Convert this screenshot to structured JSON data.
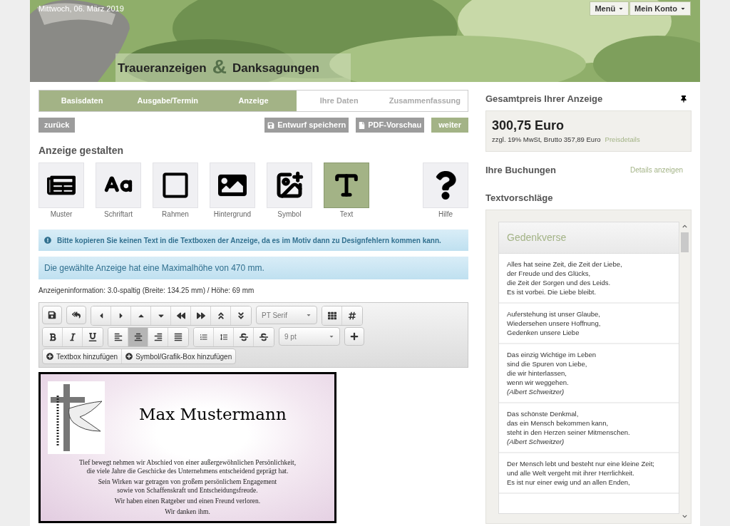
{
  "header": {
    "date": "Mittwoch, 06. März 2019",
    "title_left": "Traueranzeigen",
    "ampersand": "&",
    "title_right": "Danksagungen",
    "menus": [
      "Menü",
      "Mein Konto"
    ]
  },
  "steps": [
    {
      "label": "Basisdaten",
      "done": true
    },
    {
      "label": "Ausgabe/Termin",
      "done": true
    },
    {
      "label": "Anzeige",
      "done": true
    },
    {
      "label": "Ihre Daten",
      "done": false
    },
    {
      "label": "Zusammenfassung",
      "done": false
    }
  ],
  "actions": {
    "back": "zurück",
    "save": "Entwurf speichern",
    "pdf": "PDF-Vorschau",
    "next": "weiter"
  },
  "design": {
    "heading": "Anzeige gestalten",
    "tools": [
      {
        "label": "Muster",
        "selected": false
      },
      {
        "label": "Schriftart",
        "selected": false
      },
      {
        "label": "Rahmen",
        "selected": false
      },
      {
        "label": "Hintergrund",
        "selected": false
      },
      {
        "label": "Symbol",
        "selected": false
      },
      {
        "label": "Text",
        "selected": true
      },
      {
        "label": "Hilfe",
        "selected": false
      }
    ]
  },
  "warning": "Bitte kopieren Sie keinen Text in die Textboxen der Anzeige, da es im Motiv dann zu Designfehlern kommen kann.",
  "info": "Die gewählte Anzeige hat eine Maximalhöhe von 470 mm.",
  "ad_info": "Anzeigeninformation: 3.0-spaltig (Breite: 134.25 mm) / Höhe: 69 mm",
  "toolbar": {
    "font": "PT Serif",
    "size": "9 pt",
    "align": [
      {
        "selected": false
      },
      {
        "selected": true
      },
      {
        "selected": false
      },
      {
        "selected": false
      }
    ],
    "add_textbox": "Textbox hinzufügen",
    "add_symbol": "Symbol/Grafik-Box hinzufügen"
  },
  "ad": {
    "name": "Max Mustermann",
    "paragraphs": [
      [
        "Tief bewegt nehmen wir Abschied von einer außergewöhnlichen Persönlichkeit,",
        "die viele Jahre die Geschicke des Unternehmens entscheidend geprägt hat."
      ],
      [
        "Sein Wirken war getragen von großem persönlichem Engagement",
        "sowie von Schaffenskraft und Entscheidungsfreude."
      ],
      [
        "Wir haben einen Ratgeber und einen Freund verloren."
      ],
      [
        "Wir danken ihm."
      ]
    ]
  },
  "sidebar": {
    "price_heading": "Gesamtpreis Ihrer Anzeige",
    "price": "300,75 Euro",
    "tax": "zzgl. 19% MwSt, Brutto 357,89 Euro",
    "price_link": "Preisdetails",
    "bookings_heading": "Ihre Buchungen",
    "bookings_link": "Details anzeigen",
    "suggestions_heading": "Textvorschläge",
    "category": "Gedenkverse",
    "verses": [
      {
        "lines": [
          "Alles hat seine Zeit, die Zeit der Liebe,",
          "der Freude und des Glücks,",
          "die Zeit der Sorgen und des Leids.",
          "Es ist vorbei. Die Liebe bleibt."
        ]
      },
      {
        "lines": [
          "Auferstehung ist unser Glaube,",
          "Wiedersehen unsere Hoffnung,",
          "Gedenken unsere Liebe"
        ]
      },
      {
        "lines": [
          "Das einzig Wichtige im Leben",
          "sind die Spuren von Liebe,",
          "die wir hinterlassen,",
          "wenn wir weggehen."
        ],
        "author": "(Albert Schweitzer)"
      },
      {
        "lines": [
          "Das schönste Denkmal,",
          "das ein Mensch bekommen kann,",
          "steht in den Herzen seiner Mitmenschen."
        ],
        "author": "(Albert Schweitzer)"
      },
      {
        "lines": [
          "Der Mensch lebt und besteht nur eine kleine Zeit;",
          "und alle Welt vergeht mit ihrer Herrlichkeit.",
          "Es ist nur einer ewig und an allen Enden,"
        ]
      }
    ]
  }
}
